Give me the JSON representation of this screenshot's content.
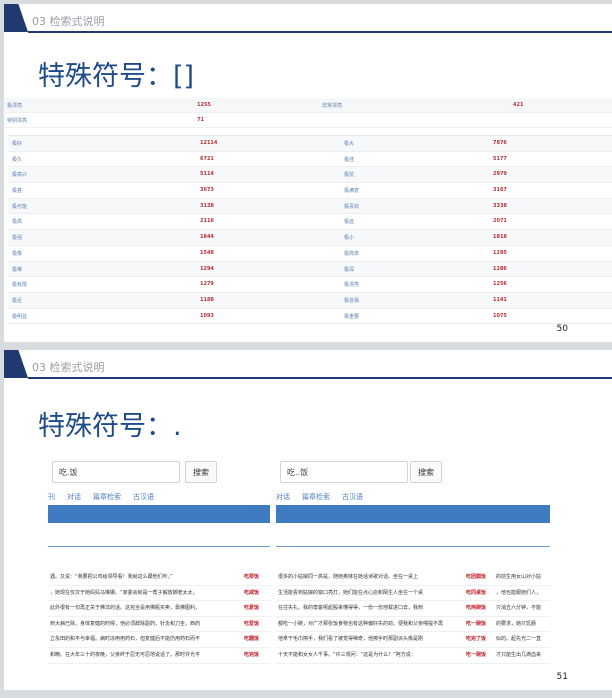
{
  "slide1": {
    "section_title": "03 检索式说明",
    "title": "特殊符号：[]",
    "page_number": "50",
    "top_rows": [
      {
        "l1": "极漂亮",
        "v1": "1255",
        "l2": "非常漂亮",
        "v2": "421"
      },
      {
        "l1": "特别漂亮",
        "v1": "71",
        "l2": "",
        "v2": ""
      }
    ],
    "rows": [
      {
        "l1": "极好",
        "v1": "12114",
        "l2": "极大",
        "v2": "7876"
      },
      {
        "l1": "极久",
        "v1": "6721",
        "l2": "极佳",
        "v2": "5177"
      },
      {
        "l1": "极高兴",
        "v1": "5114",
        "l2": "极抗",
        "v2": "2979"
      },
      {
        "l1": "极甚",
        "v1": "3673",
        "l2": "极满意",
        "v2": "3167"
      },
      {
        "l1": "极可能",
        "v1": "3138",
        "l2": "极喜欢",
        "v2": "3338"
      },
      {
        "l1": "极高",
        "v1": "2116",
        "l2": "极远",
        "v2": "2071"
      },
      {
        "l1": "极强",
        "v1": "1844",
        "l2": "极小",
        "v2": "1818"
      },
      {
        "l1": "极像",
        "v1": "1548",
        "l2": "极简单",
        "v2": "1295"
      },
      {
        "l1": "极难",
        "v1": "1294",
        "l2": "极深",
        "v2": "1286"
      },
      {
        "l1": "极有限",
        "v1": "1279",
        "l2": "极漂亮",
        "v2": "1256"
      },
      {
        "l1": "极近",
        "v1": "1188",
        "l2": "极容易",
        "v2": "1141"
      },
      {
        "l1": "极明显",
        "v1": "1093",
        "l2": "极重要",
        "v2": "1075"
      }
    ]
  },
  "slide2": {
    "section_title": "03 检索式说明",
    "title": "特殊符号：.",
    "page_number": "51",
    "left_pane": {
      "query": "吃.饭",
      "button": "搜索",
      "tabs": [
        "刊",
        "对话",
        "篇章检索",
        "古汉语"
      ],
      "rows": [
        {
          "text": "遇。又说：“我要把公鸡给领导看！我就这么跟他们吵。”",
          "tail": "破，我父亲",
          "kw": "吃那饭"
        },
        {
          "text": "，她现在仅次于她妈妈马琳娜。“家委会就是一帮子解放脚老太太，",
          "tail": "",
          "kw": "吃咸饭"
        },
        {
          "text": "此外很有一句再正关于佛法的话。这完全是用佛瓶买卖，靠佛图利，",
          "tail": "",
          "kw": "吃素饭"
        },
        {
          "text": "到大病已除，身体复健的时候，他必须辞除副药，针灸和刀圭，西药",
          "tail": "",
          "kw": "吃爱饭"
        },
        {
          "text": "立永田的和平与幸福。病时凉用用药石，但复健后不能仍用药石而不",
          "tail": "",
          "kw": "吃翻饭"
        },
        {
          "text": "和精。在大年三十的夜晚，父亲终于忍无可忍地说话了。那时许光平",
          "tail": "",
          "kw": "吃完饭"
        }
      ]
    },
    "right_pane": {
      "query": "吃..饭",
      "button": "搜索",
      "tabs": [
        "对话",
        "篇章检索",
        "古汉语"
      ],
      "rows": [
        {
          "text": "很多的小姑娘同一高是，随她奥妹在她话诗歌对话。坐在一桌上",
          "kw": "吃团圆饭",
          "tail": "的前生用女山对小姑"
        },
        {
          "text": "生活能看到姑娘的窗口亮灯，她们能在点心店和陌生人坐在一个桌",
          "kw": "吃同桌饭",
          "tail": "，他也能跟她们人，"
        },
        {
          "text": "在往失礼。我的尊客呢起殷来懂得得，一份一份地载进口去，我到",
          "kw": "吃两碗饭",
          "tail": "只消五六分钟，不能"
        },
        {
          "text": "都吃一小碗，对广才那张饭食物也有这种偏好失的劲，便我和父亲喂提不再",
          "kw": "吃一碗饭",
          "tail": "的要求，她只饥肠"
        },
        {
          "text": "他拿干毛巾擦手，我们看了被觉得稀奇，他擦手时那副派头像是刚",
          "kw": "吃完了饭",
          "tail": "似的。起先光二一直"
        },
        {
          "text": "十天不能和女女人千事。“许三观问：“这是为什么？”阿方说：",
          "kw": "吃一碗饭",
          "tail": "才只能生出几滴血来"
        }
      ]
    }
  }
}
